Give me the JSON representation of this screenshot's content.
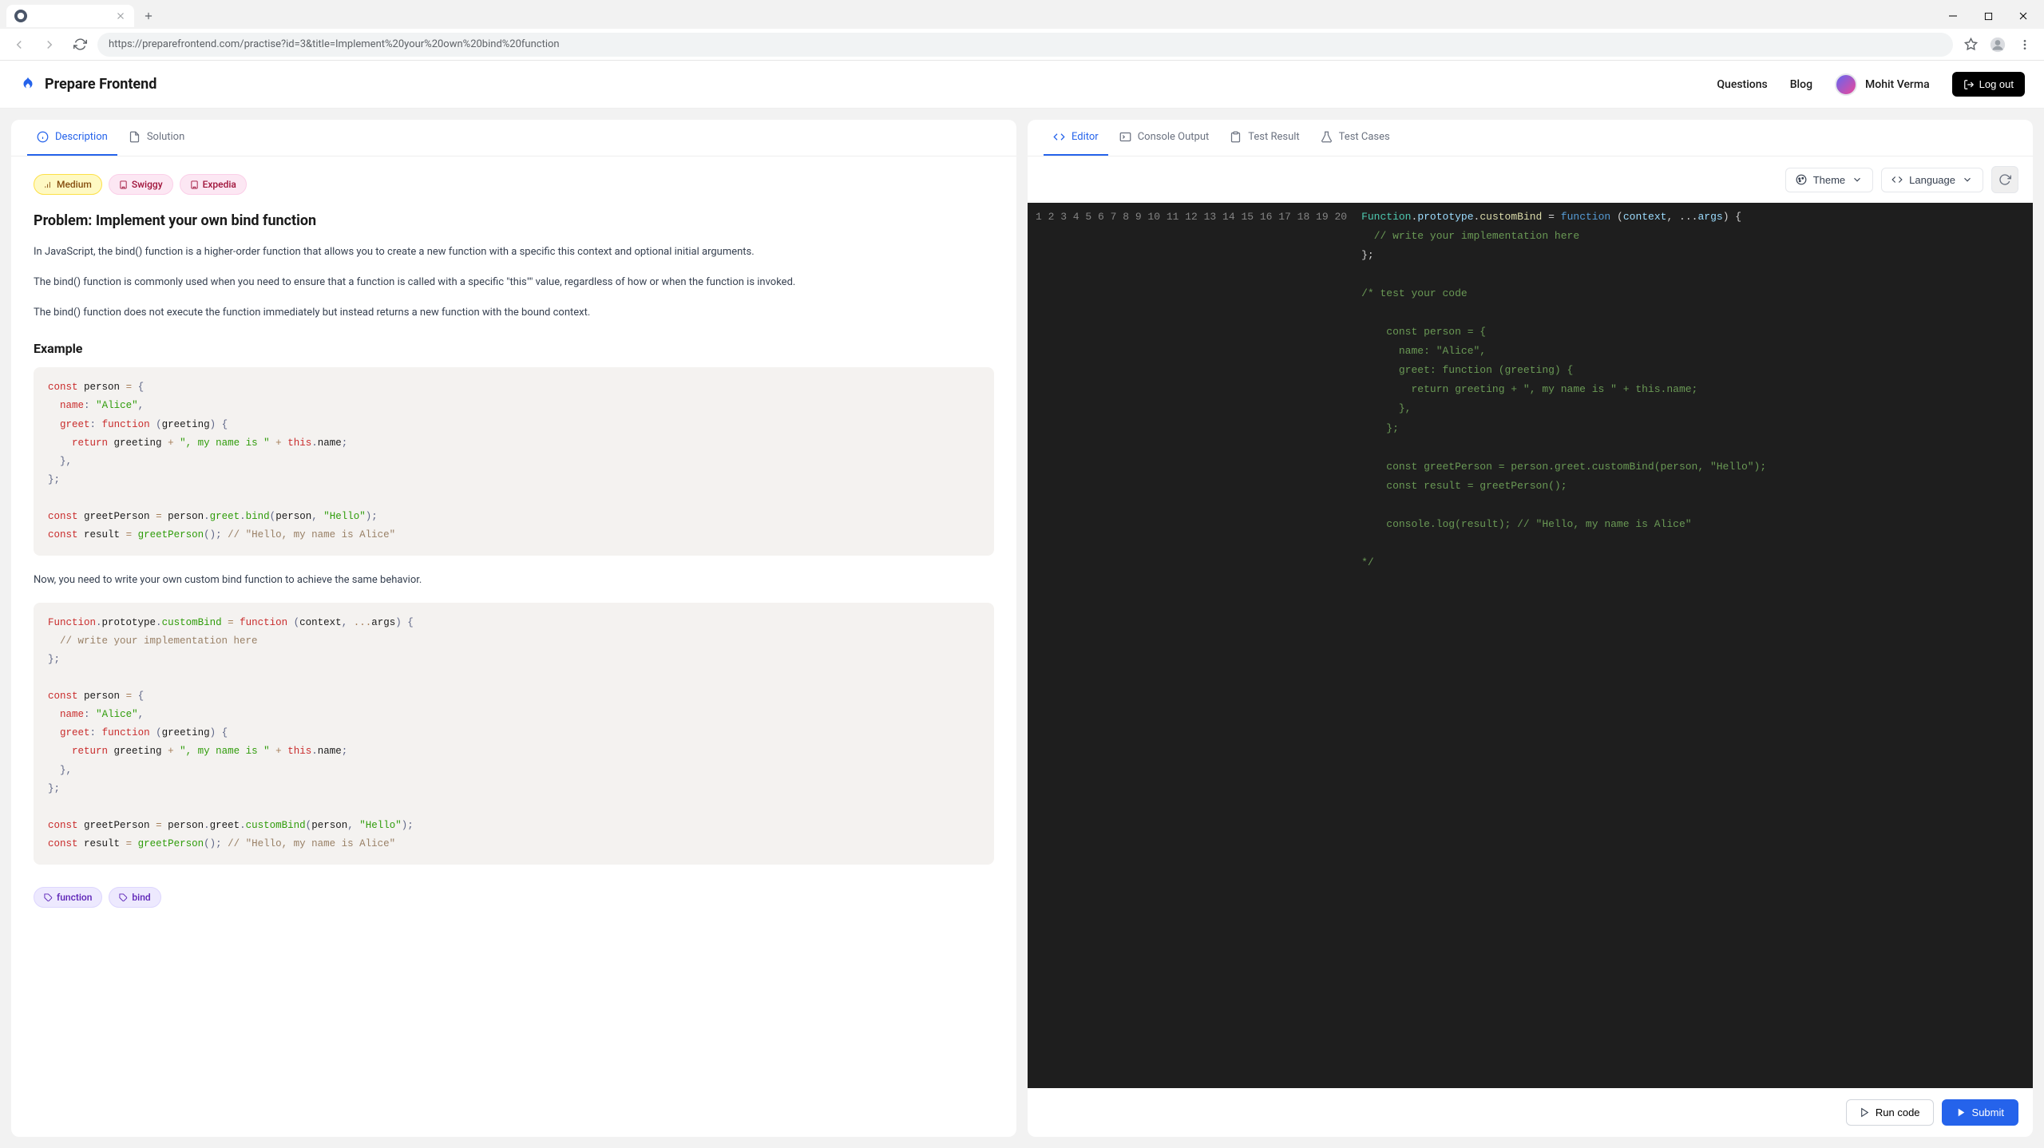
{
  "browser": {
    "tab_title": "",
    "url": "https://preparefrontend.com/practise?id=3&title=Implement%20your%20own%20bind%20function"
  },
  "header": {
    "brand": "Prepare Frontend",
    "nav": {
      "questions": "Questions",
      "blog": "Blog"
    },
    "user_name": "Mohit Verma",
    "logout": "Log out"
  },
  "left_tabs": {
    "desc": "Description",
    "solution": "Solution"
  },
  "right_tabs": {
    "editor": "Editor",
    "console": "Console Output",
    "result": "Test Result",
    "cases": "Test Cases"
  },
  "tags": {
    "difficulty": "Medium",
    "company1": "Swiggy",
    "company2": "Expedia",
    "concept1": "function",
    "concept2": "bind"
  },
  "problem": {
    "title": "Problem: Implement your own bind function",
    "p1": "In JavaScript, the bind() function is a higher-order function that allows you to create a new function with a specific this context and optional initial arguments.",
    "p2": "The bind() function is commonly used when you need to ensure that a function is called with a specific \"this\"\" value, regardless of how or when the function is invoked.",
    "p3": "The bind() function does not execute the function immediately but instead returns a new function with the bound context.",
    "example_heading": "Example",
    "p4": "Now, you need to write your own custom bind function to achieve the same behavior."
  },
  "toolbar": {
    "theme": "Theme",
    "language": "Language"
  },
  "actions": {
    "run": "Run code",
    "submit": "Submit"
  },
  "editor_lines": 20
}
